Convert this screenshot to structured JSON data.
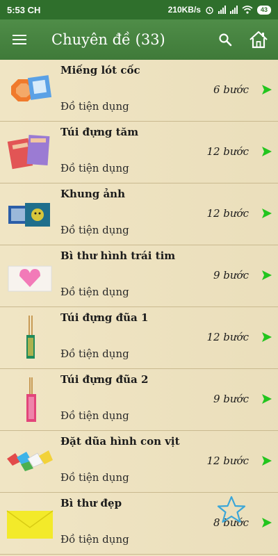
{
  "status": {
    "time": "5:53 CH",
    "speed": "210KB/s",
    "battery": "43"
  },
  "appbar": {
    "title": "Chuyên đề (33)"
  },
  "items": [
    {
      "title": "Miếng lót cốc",
      "category": "Đồ tiện dụng",
      "steps": "6 bước"
    },
    {
      "title": "Túi đựng tăm",
      "category": "Đồ tiện dụng",
      "steps": "12 bước"
    },
    {
      "title": "Khung ảnh",
      "category": "Đồ tiện dụng",
      "steps": "12 bước"
    },
    {
      "title": "Bì thư hình trái tim",
      "category": "Đồ tiện dụng",
      "steps": "9 bước"
    },
    {
      "title": "Túi đựng đũa 1",
      "category": "Đồ tiện dụng",
      "steps": "12 bước"
    },
    {
      "title": "Túi đựng đũa 2",
      "category": "Đồ tiện dụng",
      "steps": "9 bước"
    },
    {
      "title": "Đặt dũa hình con vịt",
      "category": "Đồ tiện dụng",
      "steps": "12 bước"
    },
    {
      "title": "Bì thư đẹp",
      "category": "Đồ tiện dụng",
      "steps": "8 bước"
    }
  ],
  "colors": {
    "appbar": "#3f7a39",
    "arrow": "#22c51e",
    "background": "#efe3bf"
  },
  "icons": [
    "menu-icon",
    "search-icon",
    "home-icon",
    "chevron-right-icon",
    "star-outline-icon"
  ]
}
